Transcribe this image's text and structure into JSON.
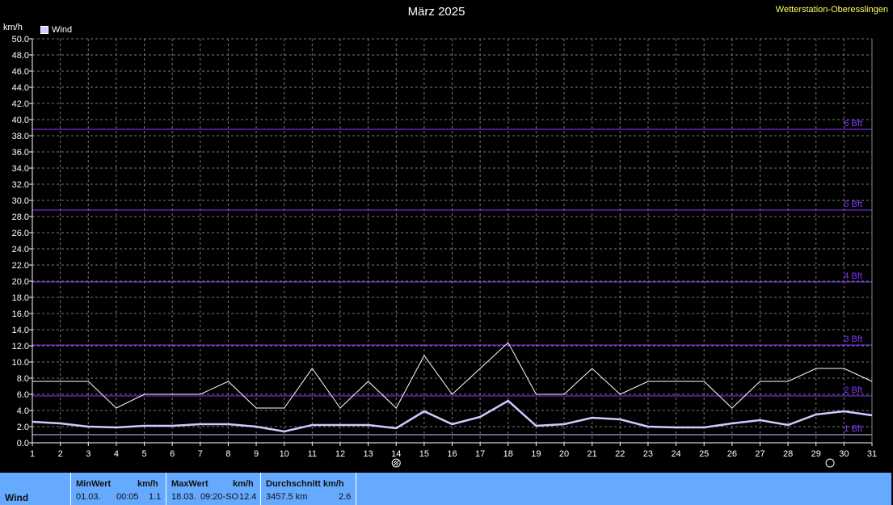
{
  "header": {
    "station": "Wetterstation-Oberesslingen"
  },
  "footer": {
    "label": "Wind",
    "min": {
      "title": "MinWert",
      "unit": "km/h",
      "date": "01.03.",
      "time": "00:05",
      "value": "1.1"
    },
    "max": {
      "title": "MaxWert",
      "unit": "km/h",
      "date": "18.03.",
      "time": "09:20-SO",
      "value": "12.4"
    },
    "avg": {
      "title": "Durchschnitt km/h",
      "distance": "3457.5 km",
      "value": "2.6"
    }
  },
  "chart_data": {
    "type": "line",
    "title": "März 2025",
    "ylabel": "km/h",
    "xlabel": "",
    "ylim": [
      0,
      50
    ],
    "ytick_step": 2,
    "xlim": [
      1,
      31
    ],
    "x": [
      1,
      2,
      3,
      4,
      5,
      6,
      7,
      8,
      9,
      10,
      11,
      12,
      13,
      14,
      15,
      16,
      17,
      18,
      19,
      20,
      21,
      22,
      23,
      24,
      25,
      26,
      27,
      28,
      29,
      30,
      31
    ],
    "series": [
      {
        "name": "Wind",
        "color": "#ccccff",
        "values": [
          2.6,
          2.4,
          2.0,
          1.9,
          2.1,
          2.1,
          2.3,
          2.3,
          2.0,
          1.4,
          2.2,
          2.2,
          2.2,
          1.8,
          3.9,
          2.3,
          3.2,
          5.2,
          2.1,
          2.3,
          3.1,
          2.9,
          2.0,
          1.9,
          1.9,
          2.4,
          2.8,
          2.2,
          3.5,
          3.9,
          3.4
        ]
      },
      {
        "color": "#ffffff",
        "values": [
          7.6,
          7.6,
          7.6,
          4.3,
          6.0,
          6.0,
          6.0,
          7.6,
          4.3,
          4.3,
          9.2,
          4.3,
          7.6,
          4.3,
          10.8,
          6.0,
          9.2,
          12.4,
          6.0,
          6.0,
          9.2,
          6.0,
          7.6,
          7.6,
          7.6,
          4.3,
          7.6,
          7.6,
          9.2,
          9.2,
          7.6
        ]
      }
    ],
    "reference_lines": [
      {
        "value": 1.0,
        "label": "1 Bft"
      },
      {
        "value": 5.8,
        "label": "2 Bft"
      },
      {
        "value": 12.1,
        "label": "3 Bft"
      },
      {
        "value": 19.9,
        "label": "4 Bft"
      },
      {
        "value": 28.8,
        "label": "5 Bft"
      },
      {
        "value": 38.8,
        "label": "6 Bft"
      }
    ],
    "reference_color": "#8833ff",
    "moon_markers": [
      {
        "day": 14,
        "phase": "full-moon"
      },
      {
        "day": 29.5,
        "phase": "new-moon"
      }
    ],
    "grid": true,
    "legend_position": "top-left"
  }
}
